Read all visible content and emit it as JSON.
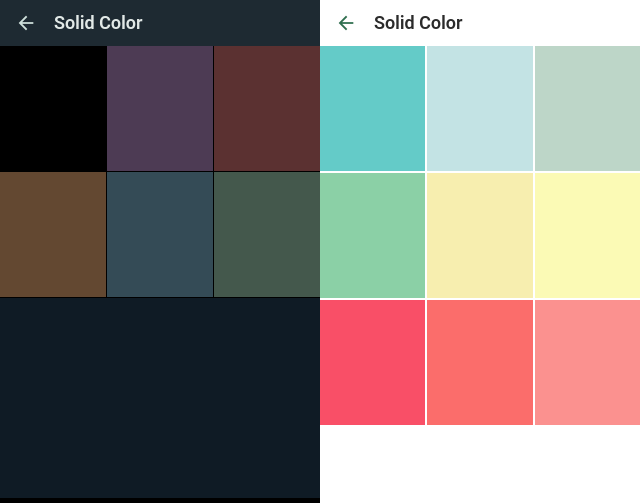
{
  "left": {
    "title": "Solid Color",
    "back_icon_color": "#cfe0db",
    "swatches": [
      {
        "name": "black",
        "hex": "#000000"
      },
      {
        "name": "plum",
        "hex": "#4d3b54"
      },
      {
        "name": "maroon",
        "hex": "#5b3131"
      },
      {
        "name": "brown",
        "hex": "#634831"
      },
      {
        "name": "slate",
        "hex": "#344b56"
      },
      {
        "name": "olive-gray",
        "hex": "#44584c"
      }
    ],
    "big_swatch": {
      "name": "midnight",
      "hex": "#0f1b25"
    }
  },
  "right": {
    "title": "Solid Color",
    "back_icon_color": "#2f6e4e",
    "swatches": [
      {
        "name": "turquoise",
        "hex": "#64cbc8"
      },
      {
        "name": "powder-blue",
        "hex": "#c3e3e4"
      },
      {
        "name": "sage",
        "hex": "#bdd6c8"
      },
      {
        "name": "mint",
        "hex": "#8bd0a6"
      },
      {
        "name": "butter",
        "hex": "#f7eeaf"
      },
      {
        "name": "lemon",
        "hex": "#fbfab5"
      },
      {
        "name": "watermelon",
        "hex": "#f94f67"
      },
      {
        "name": "coral",
        "hex": "#fb6d6b"
      },
      {
        "name": "salmon",
        "hex": "#fb918f"
      }
    ]
  }
}
